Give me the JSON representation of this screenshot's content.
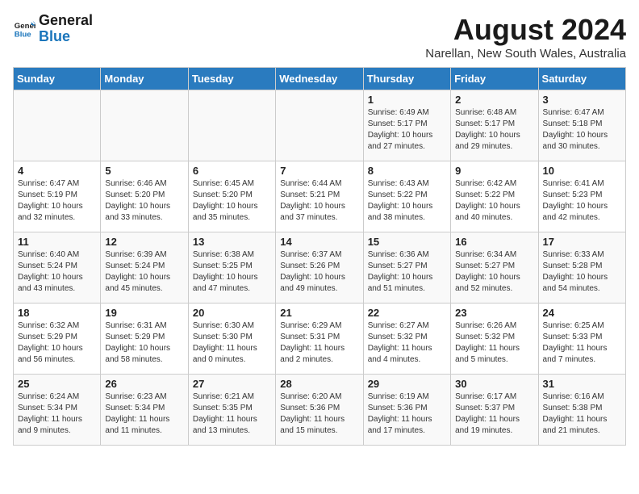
{
  "logo": {
    "general": "General",
    "blue": "Blue"
  },
  "title": "August 2024",
  "subtitle": "Narellan, New South Wales, Australia",
  "weekdays": [
    "Sunday",
    "Monday",
    "Tuesday",
    "Wednesday",
    "Thursday",
    "Friday",
    "Saturday"
  ],
  "weeks": [
    [
      {
        "day": "",
        "sunrise": "",
        "sunset": "",
        "daylight": "",
        "empty": true
      },
      {
        "day": "",
        "sunrise": "",
        "sunset": "",
        "daylight": "",
        "empty": true
      },
      {
        "day": "",
        "sunrise": "",
        "sunset": "",
        "daylight": "",
        "empty": true
      },
      {
        "day": "",
        "sunrise": "",
        "sunset": "",
        "daylight": "",
        "empty": true
      },
      {
        "day": "1",
        "sunrise": "Sunrise: 6:49 AM",
        "sunset": "Sunset: 5:17 PM",
        "daylight": "Daylight: 10 hours and 27 minutes."
      },
      {
        "day": "2",
        "sunrise": "Sunrise: 6:48 AM",
        "sunset": "Sunset: 5:17 PM",
        "daylight": "Daylight: 10 hours and 29 minutes."
      },
      {
        "day": "3",
        "sunrise": "Sunrise: 6:47 AM",
        "sunset": "Sunset: 5:18 PM",
        "daylight": "Daylight: 10 hours and 30 minutes."
      }
    ],
    [
      {
        "day": "4",
        "sunrise": "Sunrise: 6:47 AM",
        "sunset": "Sunset: 5:19 PM",
        "daylight": "Daylight: 10 hours and 32 minutes."
      },
      {
        "day": "5",
        "sunrise": "Sunrise: 6:46 AM",
        "sunset": "Sunset: 5:20 PM",
        "daylight": "Daylight: 10 hours and 33 minutes."
      },
      {
        "day": "6",
        "sunrise": "Sunrise: 6:45 AM",
        "sunset": "Sunset: 5:20 PM",
        "daylight": "Daylight: 10 hours and 35 minutes."
      },
      {
        "day": "7",
        "sunrise": "Sunrise: 6:44 AM",
        "sunset": "Sunset: 5:21 PM",
        "daylight": "Daylight: 10 hours and 37 minutes."
      },
      {
        "day": "8",
        "sunrise": "Sunrise: 6:43 AM",
        "sunset": "Sunset: 5:22 PM",
        "daylight": "Daylight: 10 hours and 38 minutes."
      },
      {
        "day": "9",
        "sunrise": "Sunrise: 6:42 AM",
        "sunset": "Sunset: 5:22 PM",
        "daylight": "Daylight: 10 hours and 40 minutes."
      },
      {
        "day": "10",
        "sunrise": "Sunrise: 6:41 AM",
        "sunset": "Sunset: 5:23 PM",
        "daylight": "Daylight: 10 hours and 42 minutes."
      }
    ],
    [
      {
        "day": "11",
        "sunrise": "Sunrise: 6:40 AM",
        "sunset": "Sunset: 5:24 PM",
        "daylight": "Daylight: 10 hours and 43 minutes."
      },
      {
        "day": "12",
        "sunrise": "Sunrise: 6:39 AM",
        "sunset": "Sunset: 5:24 PM",
        "daylight": "Daylight: 10 hours and 45 minutes."
      },
      {
        "day": "13",
        "sunrise": "Sunrise: 6:38 AM",
        "sunset": "Sunset: 5:25 PM",
        "daylight": "Daylight: 10 hours and 47 minutes."
      },
      {
        "day": "14",
        "sunrise": "Sunrise: 6:37 AM",
        "sunset": "Sunset: 5:26 PM",
        "daylight": "Daylight: 10 hours and 49 minutes."
      },
      {
        "day": "15",
        "sunrise": "Sunrise: 6:36 AM",
        "sunset": "Sunset: 5:27 PM",
        "daylight": "Daylight: 10 hours and 51 minutes."
      },
      {
        "day": "16",
        "sunrise": "Sunrise: 6:34 AM",
        "sunset": "Sunset: 5:27 PM",
        "daylight": "Daylight: 10 hours and 52 minutes."
      },
      {
        "day": "17",
        "sunrise": "Sunrise: 6:33 AM",
        "sunset": "Sunset: 5:28 PM",
        "daylight": "Daylight: 10 hours and 54 minutes."
      }
    ],
    [
      {
        "day": "18",
        "sunrise": "Sunrise: 6:32 AM",
        "sunset": "Sunset: 5:29 PM",
        "daylight": "Daylight: 10 hours and 56 minutes."
      },
      {
        "day": "19",
        "sunrise": "Sunrise: 6:31 AM",
        "sunset": "Sunset: 5:29 PM",
        "daylight": "Daylight: 10 hours and 58 minutes."
      },
      {
        "day": "20",
        "sunrise": "Sunrise: 6:30 AM",
        "sunset": "Sunset: 5:30 PM",
        "daylight": "Daylight: 11 hours and 0 minutes."
      },
      {
        "day": "21",
        "sunrise": "Sunrise: 6:29 AM",
        "sunset": "Sunset: 5:31 PM",
        "daylight": "Daylight: 11 hours and 2 minutes."
      },
      {
        "day": "22",
        "sunrise": "Sunrise: 6:27 AM",
        "sunset": "Sunset: 5:32 PM",
        "daylight": "Daylight: 11 hours and 4 minutes."
      },
      {
        "day": "23",
        "sunrise": "Sunrise: 6:26 AM",
        "sunset": "Sunset: 5:32 PM",
        "daylight": "Daylight: 11 hours and 5 minutes."
      },
      {
        "day": "24",
        "sunrise": "Sunrise: 6:25 AM",
        "sunset": "Sunset: 5:33 PM",
        "daylight": "Daylight: 11 hours and 7 minutes."
      }
    ],
    [
      {
        "day": "25",
        "sunrise": "Sunrise: 6:24 AM",
        "sunset": "Sunset: 5:34 PM",
        "daylight": "Daylight: 11 hours and 9 minutes."
      },
      {
        "day": "26",
        "sunrise": "Sunrise: 6:23 AM",
        "sunset": "Sunset: 5:34 PM",
        "daylight": "Daylight: 11 hours and 11 minutes."
      },
      {
        "day": "27",
        "sunrise": "Sunrise: 6:21 AM",
        "sunset": "Sunset: 5:35 PM",
        "daylight": "Daylight: 11 hours and 13 minutes."
      },
      {
        "day": "28",
        "sunrise": "Sunrise: 6:20 AM",
        "sunset": "Sunset: 5:36 PM",
        "daylight": "Daylight: 11 hours and 15 minutes."
      },
      {
        "day": "29",
        "sunrise": "Sunrise: 6:19 AM",
        "sunset": "Sunset: 5:36 PM",
        "daylight": "Daylight: 11 hours and 17 minutes."
      },
      {
        "day": "30",
        "sunrise": "Sunrise: 6:17 AM",
        "sunset": "Sunset: 5:37 PM",
        "daylight": "Daylight: 11 hours and 19 minutes."
      },
      {
        "day": "31",
        "sunrise": "Sunrise: 6:16 AM",
        "sunset": "Sunset: 5:38 PM",
        "daylight": "Daylight: 11 hours and 21 minutes."
      }
    ]
  ]
}
